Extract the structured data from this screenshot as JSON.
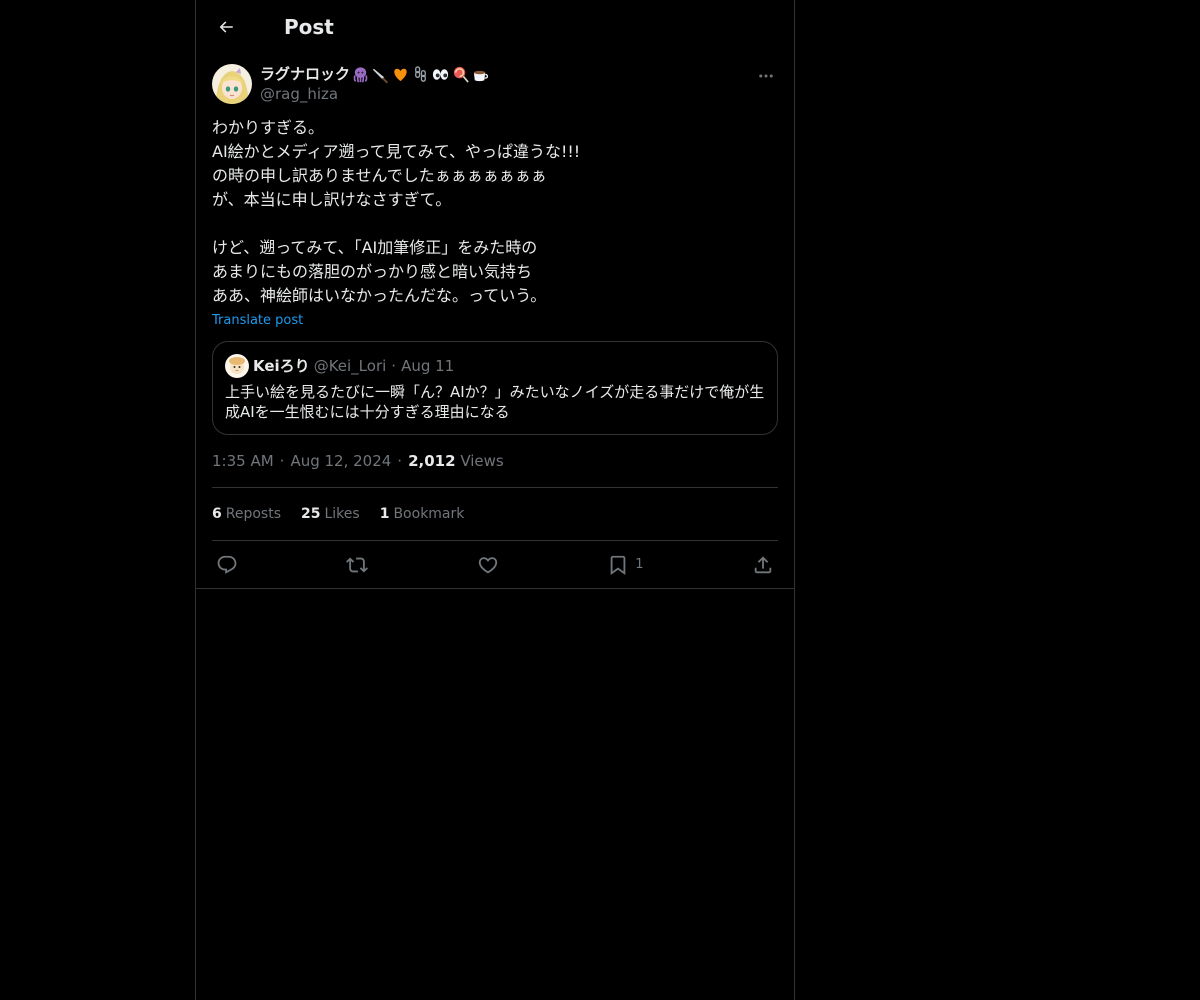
{
  "header": {
    "title": "Post"
  },
  "author": {
    "display_name": "ラグナロック",
    "handle": "@rag_hiza"
  },
  "post": {
    "lines": [
      "わかりすぎる。",
      "AI絵かとメディア遡って見てみて、やっぱ違うな!!!",
      "の時の申し訳ありませんでしたぁぁぁぁぁぁぁ",
      "が、本当に申し訳けなさすぎて。",
      "",
      "けど、遡ってみて、「AI加筆修正」をみた時の",
      "あまりにもの落胆のがっかり感と暗い気持ち",
      "ああ、神絵師はいなかったんだな。っていう。"
    ],
    "translate_label": "Translate post"
  },
  "quote": {
    "name": "Keiろり",
    "handle": "@Kei_Lori",
    "dot": "·",
    "date": "Aug 11",
    "text": "上手い絵を見るたびに一瞬「ん？AIか？」みたいなノイズが走る事だけで俺が生成AIを一生恨むには十分すぎる理由になる"
  },
  "meta": {
    "time": "1:35 AM",
    "sep": "·",
    "date": "Aug 12, 2024",
    "views_count": "2,012",
    "views_label": "Views"
  },
  "stats": {
    "reposts_count": "6",
    "reposts_label": "Reposts",
    "likes_count": "25",
    "likes_label": "Likes",
    "bookmarks_count": "1",
    "bookmarks_label": "Bookmark"
  },
  "actions": {
    "bookmark_count": "1"
  },
  "icons": {
    "back": "arrow-left-icon",
    "more": "more-horizontal-icon",
    "reply": "reply-icon",
    "repost": "repost-icon",
    "like": "heart-icon",
    "bookmark": "bookmark-icon",
    "share": "share-icon"
  },
  "colors": {
    "background": "#000000",
    "text": "#e7e9ea",
    "secondary": "#71767b",
    "accent": "#1d9bf0",
    "border": "#2f3336"
  }
}
